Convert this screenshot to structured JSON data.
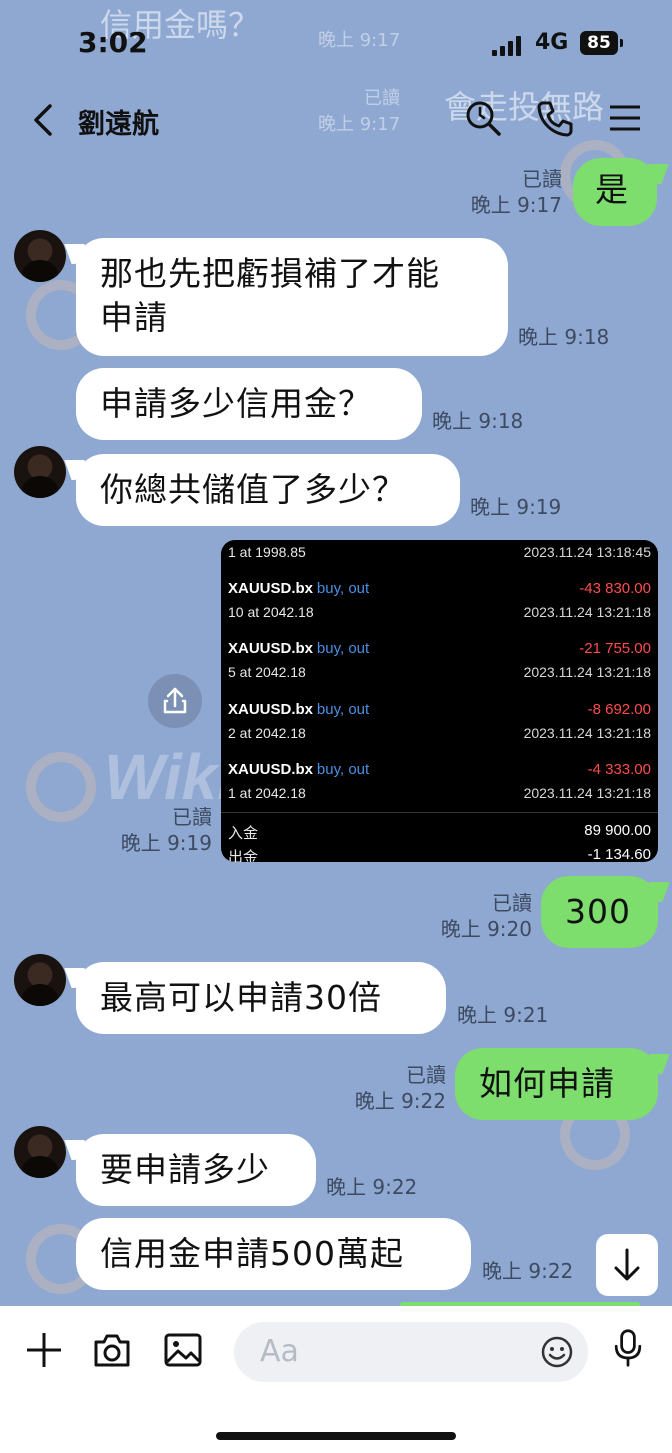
{
  "ghost": {
    "text1": "信用金嗎？",
    "text2": "會走投無路",
    "small1": "晚上 9:17",
    "small2": "已讀",
    "small3": "晚上 9:17"
  },
  "status": {
    "time": "3:02",
    "network": "4G",
    "battery": "85"
  },
  "header": {
    "title": "劉遠航"
  },
  "watermark": "WikiFX",
  "messages": [
    {
      "text": "是",
      "read": "已讀",
      "time": "晚上 9:17"
    },
    {
      "text": "那也先把虧損補了才能申請",
      "line1": "那也先把虧損補了才能",
      "line2": "申請",
      "time": "晚上 9:18"
    },
    {
      "text": "申請多少信用金？",
      "time": "晚上 9:18"
    },
    {
      "text": "你總共儲值了多少？",
      "time": "晚上 9:19"
    },
    {
      "read": "已讀",
      "time": "晚上 9:19"
    },
    {
      "text": "300",
      "read": "已讀",
      "time": "晚上 9:20"
    },
    {
      "text": "最高可以申請30倍",
      "time": "晚上 9:21"
    },
    {
      "text": "如何申請",
      "read": "已讀",
      "time": "晚上 9:22"
    },
    {
      "text": "要申請多少",
      "time": "晚上 9:22"
    },
    {
      "text": "信用金申請500萬起",
      "time": "晚上 9:22"
    }
  ],
  "screenshot": {
    "top": {
      "left": "1 at 1998.85",
      "right": "2023.11.24 13:18:45"
    },
    "trades": [
      {
        "symbol": "XAUUSD.bx",
        "action": "buy, out",
        "amount": "-43 830.00",
        "detail": "10 at 2042.18",
        "date": "2023.11.24 13:21:18"
      },
      {
        "symbol": "XAUUSD.bx",
        "action": "buy, out",
        "amount": "-21 755.00",
        "detail": "5 at 2042.18",
        "date": "2023.11.24 13:21:18"
      },
      {
        "symbol": "XAUUSD.bx",
        "action": "buy, out",
        "amount": "-8 692.00",
        "detail": "2 at 2042.18",
        "date": "2023.11.24 13:21:18"
      },
      {
        "symbol": "XAUUSD.bx",
        "action": "buy, out",
        "amount": "-4 333.00",
        "detail": "1 at 2042.18",
        "date": "2023.11.24 13:21:18"
      }
    ],
    "deposit": {
      "label": "入金",
      "value": "89 900.00"
    },
    "withdraw": {
      "label": "出金",
      "value": "-1 134.60"
    }
  },
  "composer": {
    "placeholder": "Aa"
  },
  "icons": [
    "back-icon",
    "search-icon",
    "phone-icon",
    "menu-icon",
    "share-icon",
    "arrow-down-icon",
    "plus-icon",
    "camera-icon",
    "image-icon",
    "emoji-icon",
    "mic-icon"
  ]
}
